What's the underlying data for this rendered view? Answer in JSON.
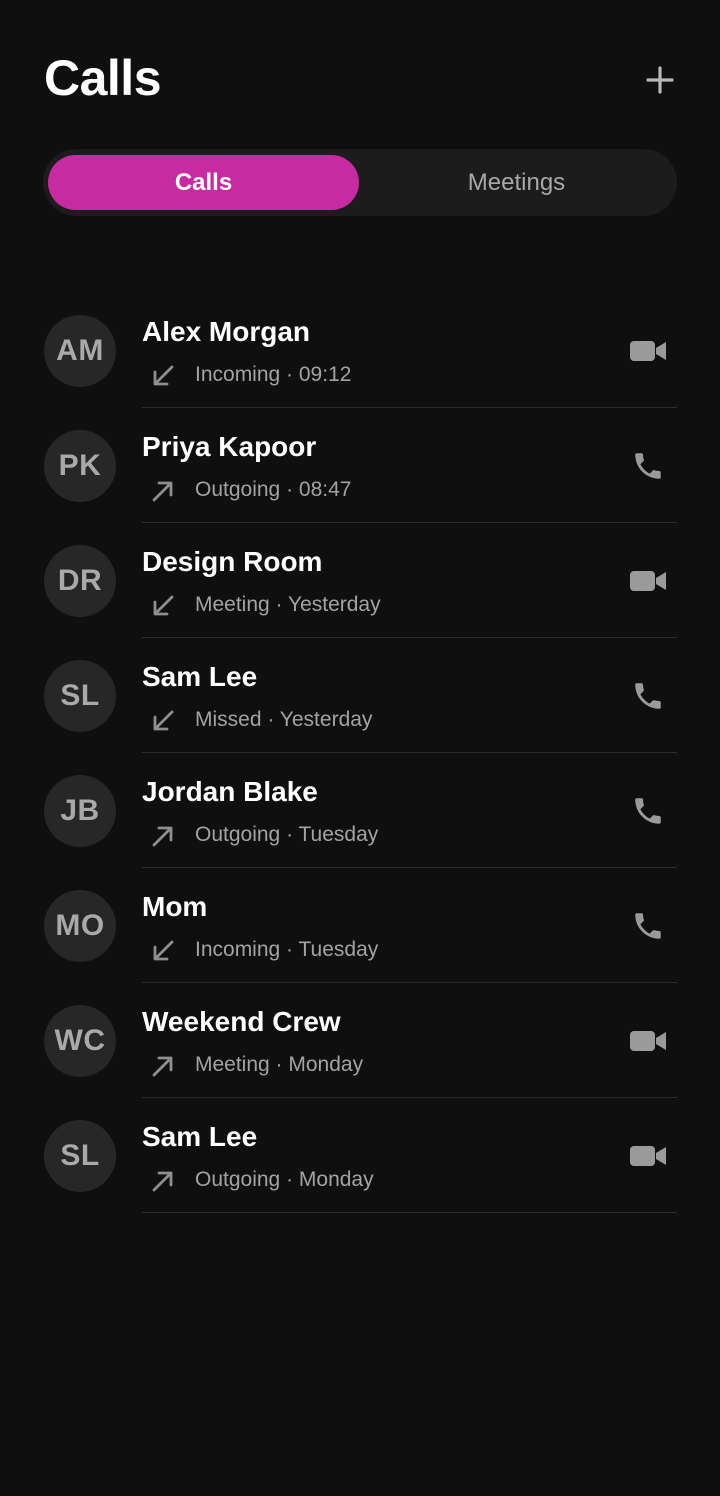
{
  "header": {
    "title": "Calls",
    "add_icon": "plus-icon"
  },
  "tabs": [
    {
      "label": "Calls",
      "active": true
    },
    {
      "label": "Meetings",
      "active": false
    }
  ],
  "colors": {
    "accent": "#c82aa2",
    "background": "#0f0f0f",
    "secondary_text": "#a3a3a3"
  },
  "calls": [
    {
      "initials": "AM",
      "name": "Alex Morgan",
      "direction": "incoming",
      "detail": "Incoming · 09:12",
      "action": "video"
    },
    {
      "initials": "PK",
      "name": "Priya Kapoor",
      "direction": "outgoing",
      "detail": "Outgoing · 08:47",
      "action": "phone"
    },
    {
      "initials": "DR",
      "name": "Design Room",
      "direction": "incoming",
      "detail": "Meeting · Yesterday",
      "action": "video"
    },
    {
      "initials": "SL",
      "name": "Sam Lee",
      "direction": "incoming",
      "detail": "Missed · Yesterday",
      "action": "phone"
    },
    {
      "initials": "JB",
      "name": "Jordan Blake",
      "direction": "outgoing",
      "detail": "Outgoing · Tuesday",
      "action": "phone"
    },
    {
      "initials": "MO",
      "name": "Mom",
      "direction": "incoming",
      "detail": "Incoming · Tuesday",
      "action": "phone"
    },
    {
      "initials": "WC",
      "name": "Weekend Crew",
      "direction": "outgoing",
      "detail": "Meeting · Monday",
      "action": "video"
    },
    {
      "initials": "SL",
      "name": "Sam Lee",
      "direction": "outgoing",
      "detail": "Outgoing · Monday",
      "action": "video"
    }
  ]
}
